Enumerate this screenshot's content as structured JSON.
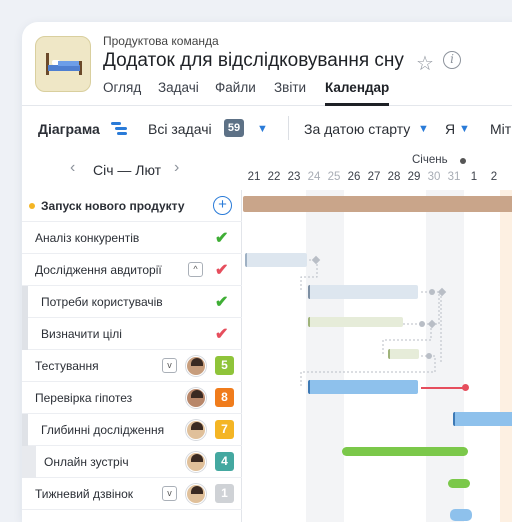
{
  "header": {
    "breadcrumb": "Продуктова команда",
    "title": "Додаток для відслідковування сну",
    "tabs": [
      "Огляд",
      "Задачі",
      "Файли",
      "Звіти",
      "Календар"
    ],
    "active_tab": "Календар"
  },
  "toolbar": {
    "view_label": "Діаграма",
    "filter_label": "Всі задачі",
    "filter_count": "59",
    "sort_label": "За датою старту",
    "assignee_label": "Я",
    "more_label": "Міт"
  },
  "nav": {
    "period": "Січ — Лют",
    "month": "Січень"
  },
  "dates": [
    "21",
    "22",
    "23",
    "24",
    "25",
    "26",
    "27",
    "28",
    "29",
    "30",
    "31",
    "1",
    "2"
  ],
  "tasks": [
    {
      "label": "Запуск нового продукту",
      "type": "group"
    },
    {
      "label": "Аналіз конкурентів",
      "status": "done"
    },
    {
      "label": "Дослідження авдиторії",
      "status": "rejected"
    },
    {
      "label": "Потреби користувачів",
      "status": "done"
    },
    {
      "label": "Визначити цілі",
      "status": "rejected"
    },
    {
      "label": "Тестування",
      "count": "5",
      "count_color": "#8fc43a"
    },
    {
      "label": "Перевірка гіпотез",
      "count": "8",
      "count_color": "#f07c1c"
    },
    {
      "label": "Глибинні дослідження",
      "count": "7",
      "count_color": "#f4b524"
    },
    {
      "label": "Онлайн зустріч",
      "count": "4",
      "count_color": "#44a8a0"
    },
    {
      "label": "Тижневий дзвінок",
      "count": "1",
      "count_color": "#cfd2d6"
    }
  ],
  "colors": {
    "accent": "#2a7bd8",
    "done": "#3fae35",
    "rejected": "#e64e5d",
    "group_bar": "#c9a58a"
  }
}
